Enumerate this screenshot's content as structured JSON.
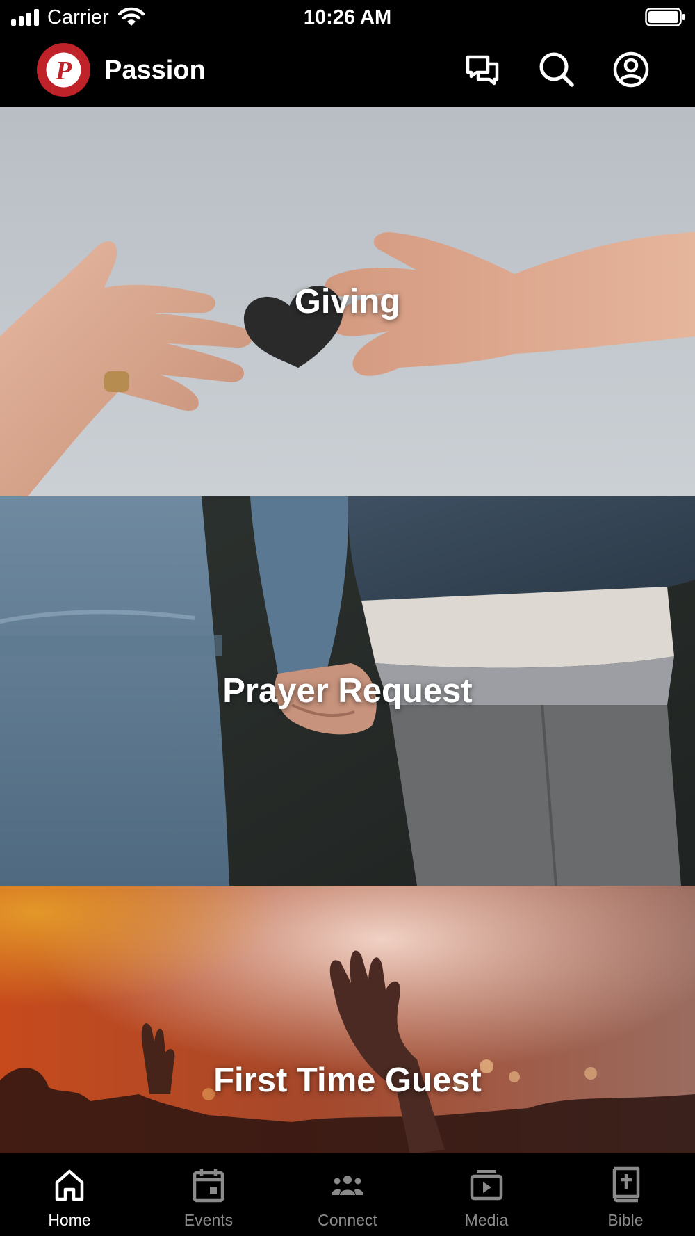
{
  "status_bar": {
    "carrier": "Carrier",
    "time": "10:26 AM"
  },
  "header": {
    "app_name": "Passion",
    "logo_letter": "P",
    "brand_color": "#c0222a",
    "actions": [
      {
        "icon": "messages-icon"
      },
      {
        "icon": "search-icon"
      },
      {
        "icon": "profile-icon"
      }
    ]
  },
  "cards": [
    {
      "title": "Giving"
    },
    {
      "title": "Prayer Request"
    },
    {
      "title": "First Time Guest"
    }
  ],
  "tabs": [
    {
      "label": "Home",
      "icon": "home-icon",
      "active": true
    },
    {
      "label": "Events",
      "icon": "calendar-icon",
      "active": false
    },
    {
      "label": "Connect",
      "icon": "people-icon",
      "active": false
    },
    {
      "label": "Media",
      "icon": "media-icon",
      "active": false
    },
    {
      "label": "Bible",
      "icon": "bible-icon",
      "active": false
    }
  ]
}
